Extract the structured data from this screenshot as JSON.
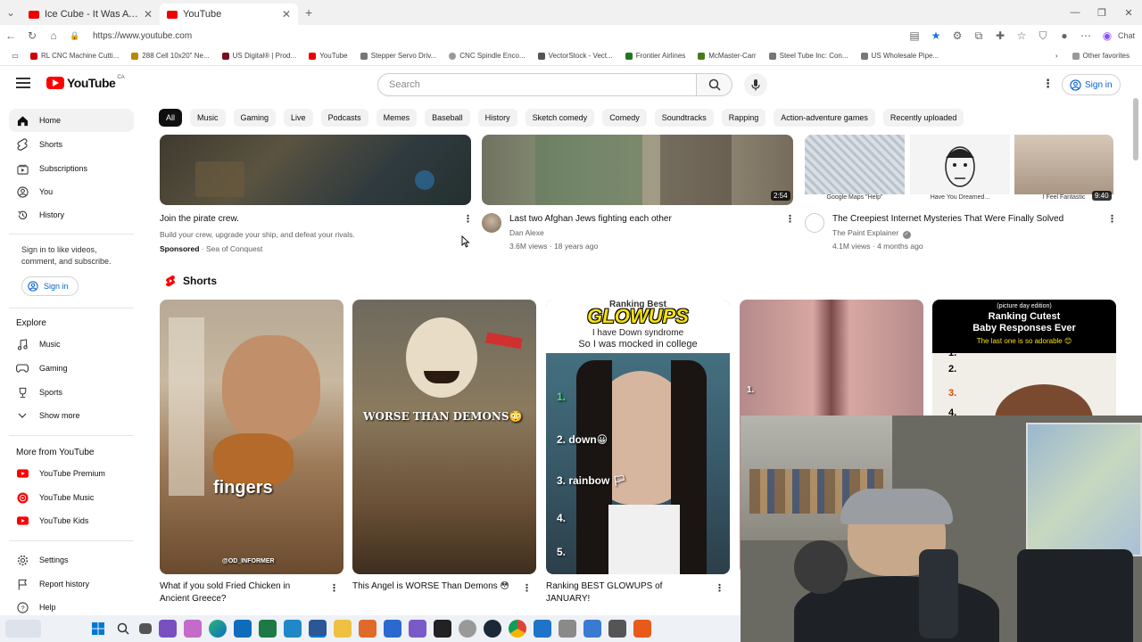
{
  "browser": {
    "tabs": [
      {
        "title": "Ice Cube - It Was A Good Day - Yo",
        "active": false
      },
      {
        "title": "YouTube",
        "active": true
      }
    ],
    "new_tab": "+",
    "url": "https://www.youtube.com",
    "bookmarks": [
      "RL CNC Machine Cutti...",
      "288 Cell 10x20\" Ne...",
      "US Digital® | Prod...",
      "YouTube",
      "Stepper Servo Driv...",
      "CNC Spindle Enco...",
      "VectorStock - Vect...",
      "Frontier Airlines",
      "McMaster-Carr",
      "Steel Tube Inc: Con...",
      "US Wholesale Pipe..."
    ],
    "other_favorites": "Other favorites",
    "chat_label": "Chat"
  },
  "youtube": {
    "logo_text": "YouTube",
    "logo_region": "CA",
    "search_placeholder": "Search",
    "signin_label": "Sign in"
  },
  "sidebar": {
    "main": [
      {
        "label": "Home",
        "icon": "home-icon",
        "active": true
      },
      {
        "label": "Shorts",
        "icon": "shorts-icon"
      },
      {
        "label": "Subscriptions",
        "icon": "subscriptions-icon"
      },
      {
        "label": "You",
        "icon": "you-icon"
      },
      {
        "label": "History",
        "icon": "history-icon"
      }
    ],
    "signin_prompt": "Sign in to like videos, comment, and subscribe.",
    "signin_label": "Sign in",
    "explore_heading": "Explore",
    "explore": [
      {
        "label": "Music",
        "icon": "music-icon"
      },
      {
        "label": "Gaming",
        "icon": "gaming-icon"
      },
      {
        "label": "Sports",
        "icon": "sports-icon"
      },
      {
        "label": "Show more",
        "icon": "chevron-down-icon"
      }
    ],
    "more_heading": "More from YouTube",
    "more": [
      {
        "label": "YouTube Premium"
      },
      {
        "label": "YouTube Music"
      },
      {
        "label": "YouTube Kids"
      }
    ],
    "footer": [
      {
        "label": "Settings",
        "icon": "settings-icon"
      },
      {
        "label": "Report history",
        "icon": "flag-icon"
      },
      {
        "label": "Help",
        "icon": "help-icon"
      }
    ]
  },
  "chips": [
    "All",
    "Music",
    "Gaming",
    "Live",
    "Podcasts",
    "Memes",
    "Baseball",
    "History",
    "Sketch comedy",
    "Comedy",
    "Soundtracks",
    "Rapping",
    "Action-adventure games",
    "Recently uploaded"
  ],
  "videos": [
    {
      "title": "Join the pirate crew.",
      "line1": "Build your crew, upgrade your ship, and defeat your rivals.",
      "sponsored": "Sponsored",
      "channel": "Sea of Conquest"
    },
    {
      "title": "Last two Afghan Jews fighting each other",
      "channel": "Dan Alexe",
      "meta": "3.6M views · 18 years ago",
      "duration": "2:54"
    },
    {
      "title": "The Creepiest Internet Mysteries That Were Finally Solved",
      "channel": "The Paint Explainer",
      "meta": "4.1M views · 4 months ago",
      "duration": "9:40",
      "thumb_captions": [
        "Google Maps \"Help\"",
        "Have You Dreamed...",
        "I Feel Fantastic"
      ]
    }
  ],
  "shorts_heading": "Shorts",
  "shorts": [
    {
      "title": "What if you sold Fried Chicken in Ancient Greece?",
      "overlay": "fingers",
      "credit": "@OD_INFORMER"
    },
    {
      "title": "This Angel is WORSE Than Demons 😳",
      "overlay": "WORSE THAN DEMONS😳"
    },
    {
      "title": "Ranking BEST GLOWUPS of JANUARY!",
      "overlay_top1": "Ranking Best",
      "overlay_top2": "GLOWUPS",
      "overlay_top3": "I have Down syndrome",
      "overlay_top4": "So I was mocked in college",
      "list": [
        "1.",
        "2. down😀",
        "3. rainbow 🏳",
        "4.",
        "5."
      ]
    },
    {
      "title": "",
      "overlay": "1."
    },
    {
      "title": "",
      "overlay_top1": "(picture day edition)",
      "overlay_top2": "Ranking Cutest",
      "overlay_top3": "Baby Responses Ever",
      "overlay_top4": "The last one is so adorable 😊",
      "list": [
        "1.",
        "2.",
        "3.",
        "4."
      ]
    }
  ]
}
